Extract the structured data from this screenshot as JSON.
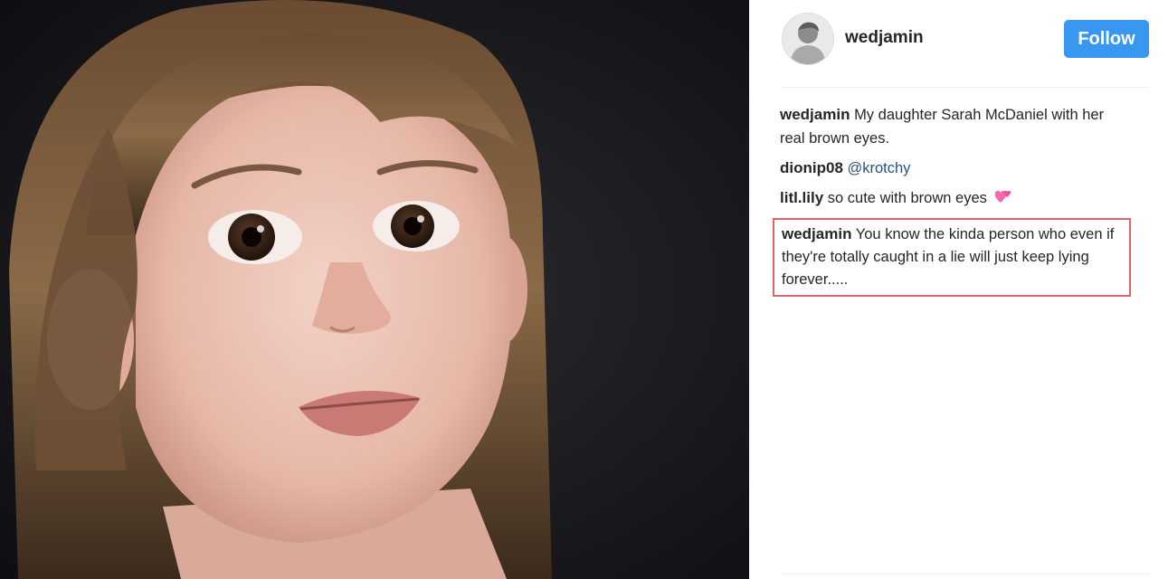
{
  "post": {
    "author": "wedjamin",
    "follow_label": "Follow",
    "avatar": "profile-photo",
    "photo": "child-portrait-photo"
  },
  "comments": [
    {
      "author": "wedjamin",
      "text": "My daughter Sarah McDaniel with her real brown eyes.",
      "highlighted": false
    },
    {
      "author": "dionip08",
      "text": "",
      "mention": "@krotchy",
      "highlighted": false
    },
    {
      "author": "litl.lily",
      "text": "so cute with brown eyes",
      "emoji": "two-hearts-icon",
      "highlighted": false
    },
    {
      "author": "wedjamin",
      "text": "You know the kinda person who even if they're totally caught in a lie will just keep lying forever.....",
      "highlighted": true
    }
  ],
  "colors": {
    "follow_button": "#3897f0",
    "highlight_border": "#e46464",
    "mention": "#2d4f82"
  }
}
